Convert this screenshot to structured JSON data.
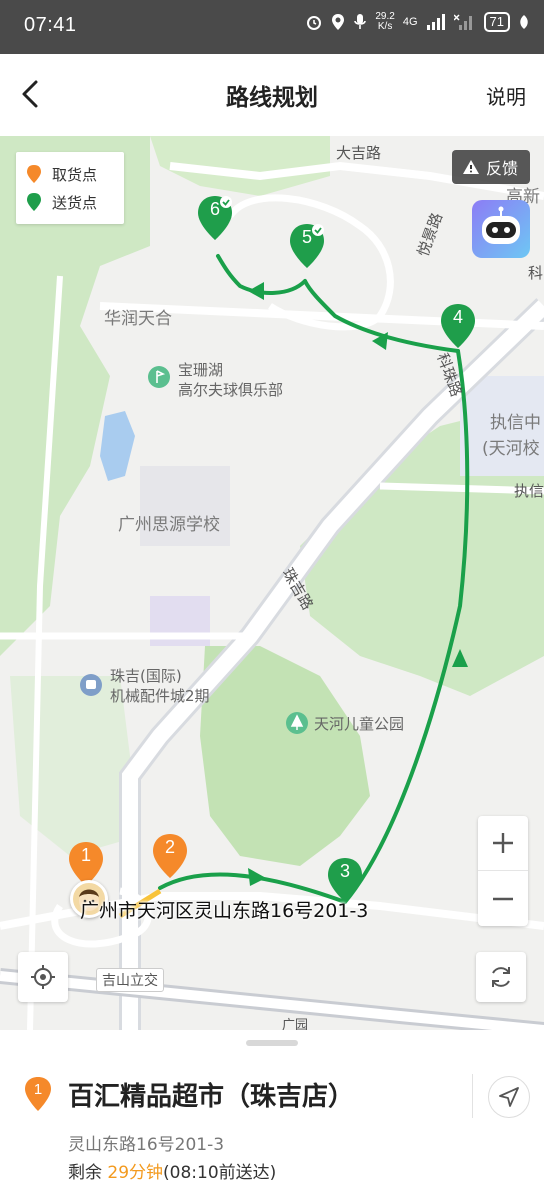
{
  "status_bar": {
    "time": "07:41",
    "speed_value": "29.2",
    "speed_unit": "K/s",
    "network": "4G",
    "battery": "71"
  },
  "header": {
    "title": "路线规划",
    "help_label": "说明"
  },
  "legend": {
    "pickup_label": "取货点",
    "delivery_label": "送货点"
  },
  "feedback_label": "反馈",
  "map": {
    "labels": {
      "road_daji": "大吉路",
      "road_yuejing": "悦景路",
      "road_kezhu": "科珠路",
      "road_zhuji": "珠吉路",
      "road_zhixin": "执信",
      "road_ke": "科",
      "gaoxin": "高新",
      "zhixin_school": "执信中",
      "zhixin_school_sub": "(天河校",
      "huarun": "华润天合",
      "golf_line1": "宝珊湖",
      "golf_line2": "高尔夫球俱乐部",
      "siyuan_school": "广州思源学校",
      "machinery_line1": "珠吉(国际)",
      "machinery_line2": "机械配件城2期",
      "park": "天河儿童公园",
      "interchange": "吉山立交",
      "guangyuan": "广园"
    },
    "pickup_points": [
      "1",
      "2"
    ],
    "delivery_points": [
      "3",
      "4",
      "5",
      "6"
    ],
    "address": "广州市天河区灵山东路16号201-3"
  },
  "sheet": {
    "order_index": "1",
    "store_name": "百汇精品超市（珠吉店）",
    "store_address": "灵山东路16号201-3",
    "remaining_prefix": "剩余",
    "remaining_time": "29分钟",
    "remaining_suffix": "(08:10前送达)"
  },
  "colors": {
    "route": "#1aa04a",
    "pickup": "#f5892a",
    "delivery": "#1f9e4b",
    "accent": "#f39a1e",
    "park_green": "#cfe8c4"
  }
}
